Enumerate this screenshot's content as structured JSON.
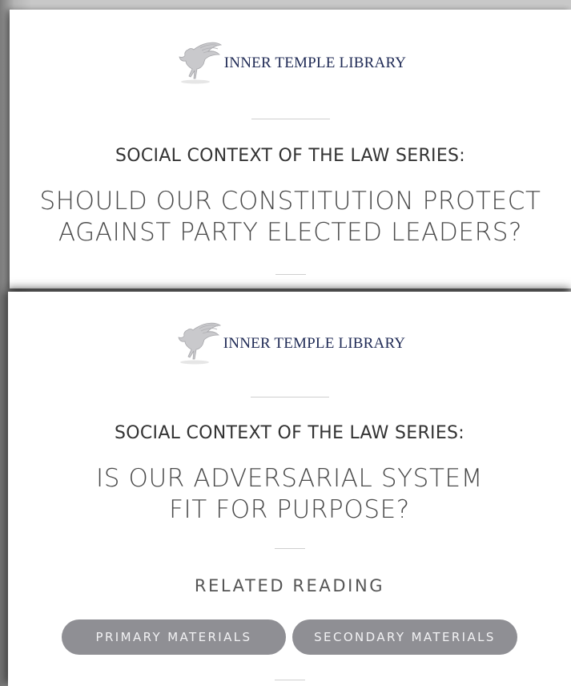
{
  "cards": [
    {
      "logo_text": "INNER TEMPLE LIBRARY",
      "series": "SOCIAL CONTEXT OF THE LAW SERIES:",
      "title_lines": [
        "SHOULD OUR CONSTITUTION PROTECT",
        "AGAINST PARTY ELECTED LEADERS?"
      ]
    },
    {
      "logo_text": "INNER TEMPLE LIBRARY",
      "series": "SOCIAL CONTEXT OF THE LAW SERIES:",
      "title_lines": [
        "IS OUR ADVERSARIAL SYSTEM",
        "FIT FOR PURPOSE?"
      ],
      "related_heading": "RELATED READING",
      "buttons": {
        "primary": "PRIMARY MATERIALS",
        "secondary": "SECONDARY MATERIALS"
      }
    }
  ],
  "icons": {
    "logo": "pegasus-icon"
  },
  "colors": {
    "logo_text": "#1f2a55",
    "button_bg": "#8f8f94",
    "button_text": "#f2f2f4",
    "rule": "#cfcfcf"
  }
}
